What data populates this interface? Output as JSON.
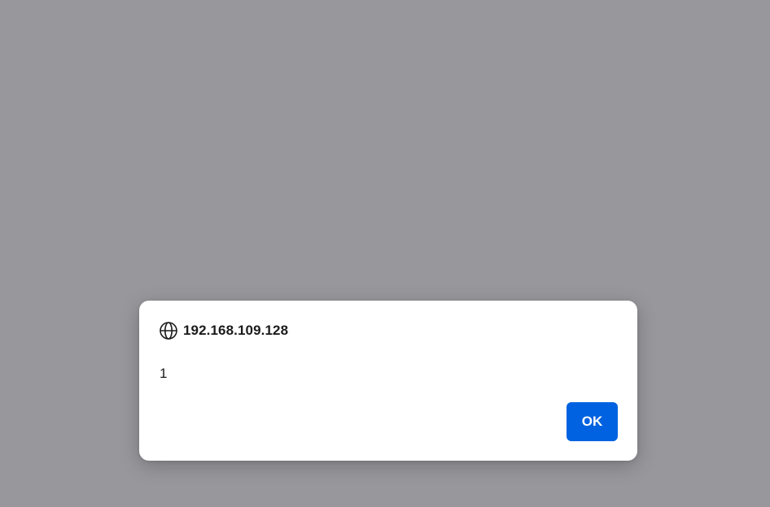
{
  "dialog": {
    "origin": "192.168.109.128",
    "origin_icon": "globe-icon",
    "message": "1",
    "ok_label": "OK"
  },
  "colors": {
    "overlay": "#98979c",
    "dialog_bg": "#ffffff",
    "button_bg": "#0062e0",
    "button_text": "#ffffff",
    "text": "#1b1b1b"
  }
}
